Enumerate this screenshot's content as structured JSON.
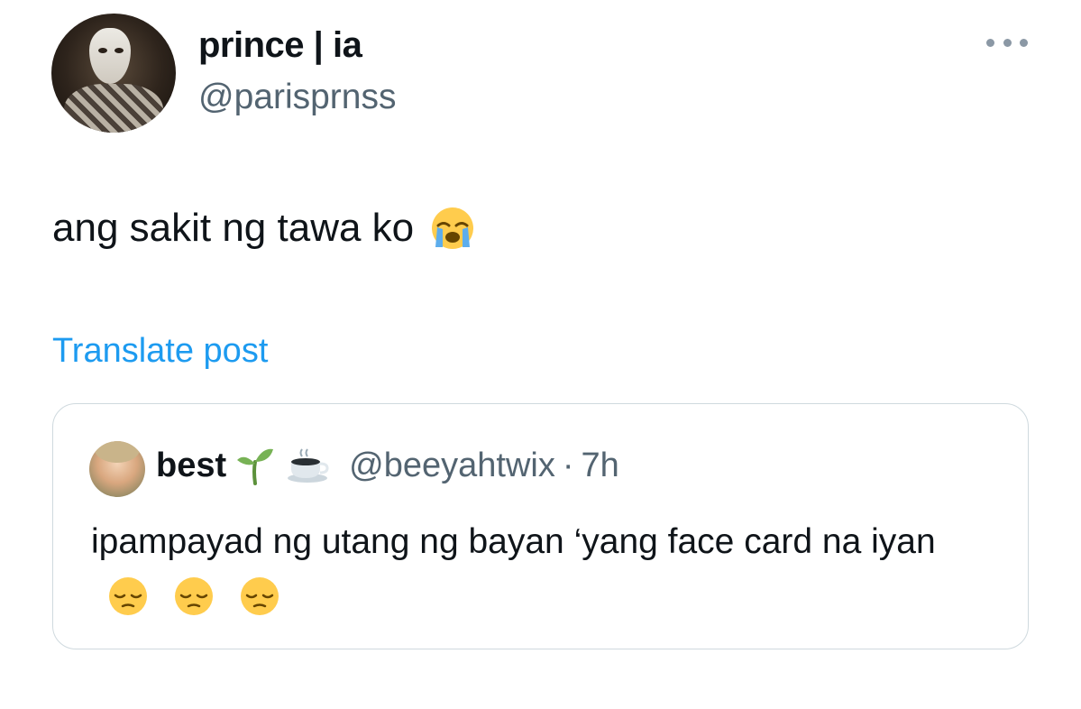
{
  "author": {
    "display_name": "prince | ia",
    "handle": "@parisprnss"
  },
  "more_icon": "more-horizontal-icon",
  "tweet": {
    "text": "ang sakit ng tawa ko",
    "emoji": "loudly-crying-face"
  },
  "translate_label": "Translate post",
  "quote": {
    "display_name": "best",
    "name_emojis": [
      "seedling",
      "hot-beverage"
    ],
    "handle": "@beeyahtwix",
    "separator": "·",
    "time": "7h",
    "text": "ipampayad ng utang ng bayan ‘yang face card na iyan",
    "trailing_emojis": [
      "pensive-face",
      "pensive-face",
      "pensive-face"
    ]
  },
  "colors": {
    "text": "#0f1419",
    "secondary": "#536471",
    "link": "#1d9bf0",
    "border": "#cfd9de"
  }
}
